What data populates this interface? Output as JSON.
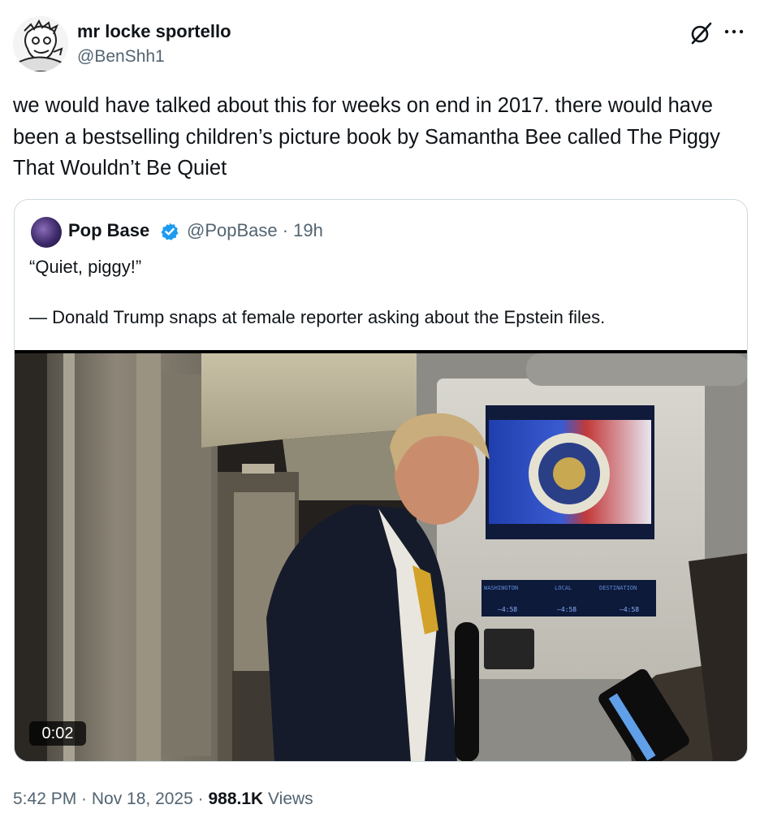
{
  "author": {
    "display_name": "mr locke sportello",
    "handle": "@BenShh1"
  },
  "tweet": {
    "text": "we would have talked about this for weeks on end in 2017. there would have been a bestselling children’s picture book by Samantha Bee called The Piggy That Wouldn’t Be Quiet"
  },
  "quoted": {
    "display_name": "Pop Base",
    "handle_time": "@PopBase · 19h",
    "line1": "“Quiet, piggy!”",
    "line2": "— Donald Trump snaps at female reporter asking about the Epstein files.",
    "video_duration": "0:02"
  },
  "video_screen": {
    "labels": [
      "WASHINGTON",
      "LOCAL",
      "DESTINATION"
    ],
    "times": [
      "—4:58",
      "—4:58",
      "—4:58"
    ]
  },
  "footer": {
    "timestamp": "5:42 PM · Nov 18, 2025 · ",
    "views_count": "988.1K",
    "views_label": " Views"
  },
  "icons": {
    "grok": "grok-slash-icon",
    "more": "more-icon",
    "verified": "verified-badge-icon"
  },
  "colors": {
    "text": "#0f1419",
    "secondary": "#536471",
    "verified": "#1d9bf0",
    "border": "#cfd9de"
  }
}
